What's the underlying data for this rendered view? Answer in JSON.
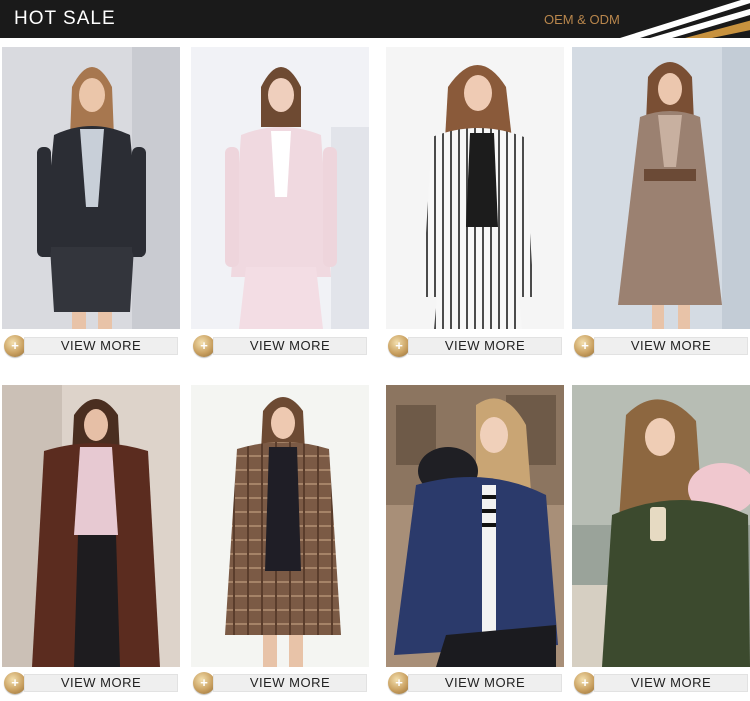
{
  "header": {
    "title": "HOT SALE",
    "subtitle": "OEM & ODM"
  },
  "colors": {
    "header_bg": "#1a1a1a",
    "accent_gold": "#b8864c",
    "button_bg": "#efefef"
  },
  "products": [
    {
      "button_label": "VIEW MORE",
      "icon": "plus-icon"
    },
    {
      "button_label": "VIEW MORE",
      "icon": "plus-icon"
    },
    {
      "button_label": "VIEW MORE",
      "icon": "plus-icon"
    },
    {
      "button_label": "VIEW MORE",
      "icon": "plus-icon"
    },
    {
      "button_label": "VIEW MORE",
      "icon": "plus-icon"
    },
    {
      "button_label": "VIEW MORE",
      "icon": "plus-icon"
    },
    {
      "button_label": "VIEW MORE",
      "icon": "plus-icon"
    },
    {
      "button_label": "VIEW MORE",
      "icon": "plus-icon"
    }
  ]
}
